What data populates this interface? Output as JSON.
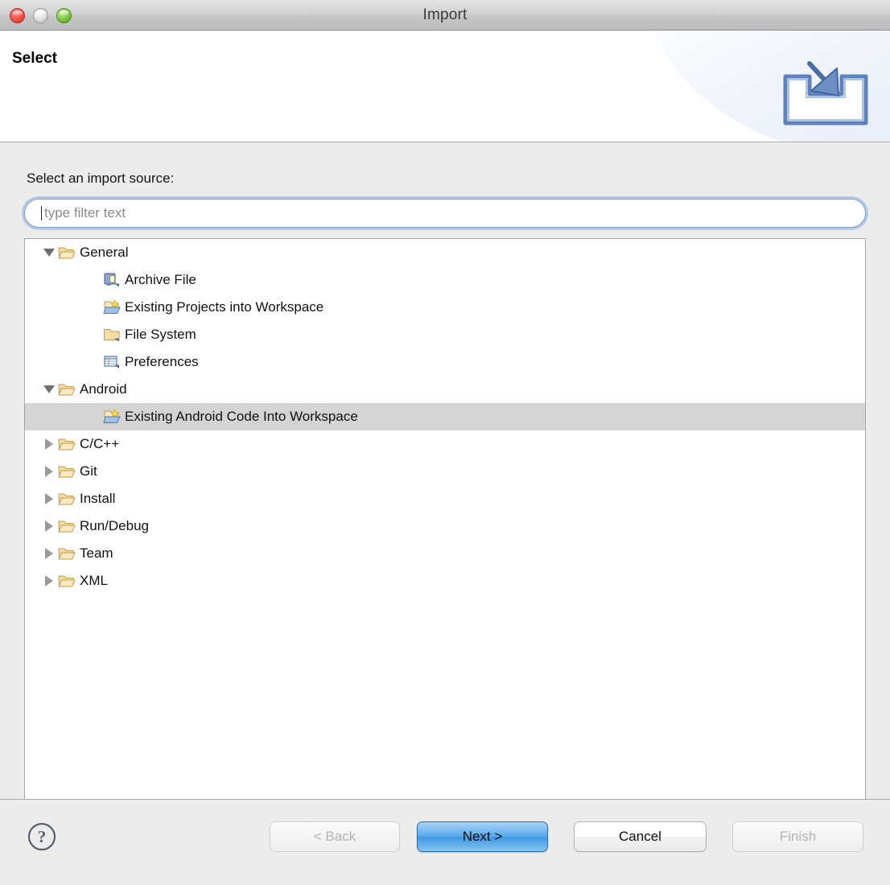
{
  "window": {
    "title": "Import",
    "traffic_lights": [
      {
        "name": "close",
        "color": "#f4574b"
      },
      {
        "name": "minimize",
        "color": "#dedede"
      },
      {
        "name": "zoom",
        "color": "#85cc4b"
      }
    ]
  },
  "header": {
    "title": "Select",
    "description": "",
    "icon": "import-wizard-icon"
  },
  "main": {
    "prompt_label": "Select an import source:",
    "filter": {
      "value": "",
      "placeholder": "type filter text"
    },
    "tree": [
      {
        "label": "General",
        "level": 0,
        "expanded": true,
        "has_children": true,
        "icon": "open-folder-icon",
        "selected": false
      },
      {
        "label": "Archive File",
        "level": 1,
        "expanded": false,
        "has_children": false,
        "icon": "archive-file-icon",
        "selected": false
      },
      {
        "label": "Existing Projects into Workspace",
        "level": 1,
        "expanded": false,
        "has_children": false,
        "icon": "import-project-icon",
        "selected": false
      },
      {
        "label": "File System",
        "level": 1,
        "expanded": false,
        "has_children": false,
        "icon": "folder-icon",
        "selected": false
      },
      {
        "label": "Preferences",
        "level": 1,
        "expanded": false,
        "has_children": false,
        "icon": "preferences-icon",
        "selected": false
      },
      {
        "label": "Android",
        "level": 0,
        "expanded": true,
        "has_children": true,
        "icon": "open-folder-icon",
        "selected": false
      },
      {
        "label": "Existing Android Code Into Workspace",
        "level": 1,
        "expanded": false,
        "has_children": false,
        "icon": "import-project-icon",
        "selected": true
      },
      {
        "label": "C/C++",
        "level": 0,
        "expanded": false,
        "has_children": true,
        "icon": "open-folder-icon",
        "selected": false
      },
      {
        "label": "Git",
        "level": 0,
        "expanded": false,
        "has_children": true,
        "icon": "open-folder-icon",
        "selected": false
      },
      {
        "label": "Install",
        "level": 0,
        "expanded": false,
        "has_children": true,
        "icon": "open-folder-icon",
        "selected": false
      },
      {
        "label": "Run/Debug",
        "level": 0,
        "expanded": false,
        "has_children": true,
        "icon": "open-folder-icon",
        "selected": false
      },
      {
        "label": "Team",
        "level": 0,
        "expanded": false,
        "has_children": true,
        "icon": "open-folder-icon",
        "selected": false
      },
      {
        "label": "XML",
        "level": 0,
        "expanded": false,
        "has_children": true,
        "icon": "open-folder-icon",
        "selected": false
      }
    ]
  },
  "footer": {
    "help_icon": "help-question-icon",
    "buttons": [
      {
        "label": "< Back",
        "state": "disabled",
        "name": "back-button"
      },
      {
        "label": "Next >",
        "state": "default",
        "name": "next-button"
      },
      {
        "label": "Cancel",
        "state": "normal",
        "name": "cancel-button"
      },
      {
        "label": "Finish",
        "state": "disabled",
        "name": "finish-button"
      }
    ]
  },
  "colors": {
    "accent_blue": "#3f97e4",
    "selection_gray": "#d4d4d4",
    "window_bg": "#ececec",
    "folder_tan": "#f5d08a"
  }
}
